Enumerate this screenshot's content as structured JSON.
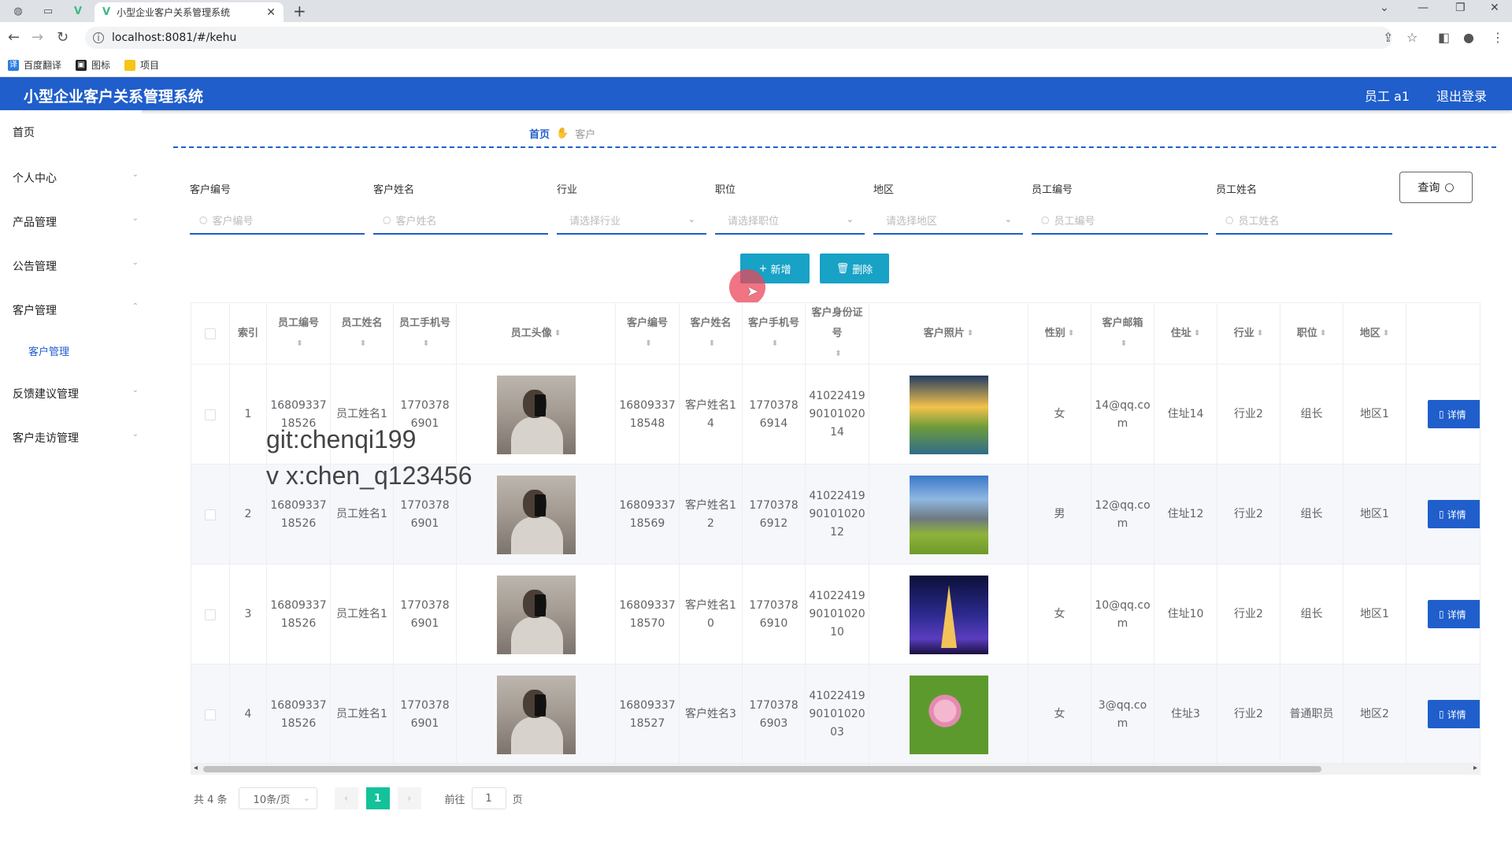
{
  "browser": {
    "tab_title": "小型企业客户关系管理系统",
    "url": "localhost:8081/#/kehu",
    "bookmarks": [
      "百度翻译",
      "图标",
      "项目"
    ]
  },
  "header": {
    "title": "小型企业客户关系管理系统",
    "user": "员工 a1",
    "logout": "退出登录"
  },
  "sidebar": {
    "items": [
      {
        "label": "首页"
      },
      {
        "label": "个人中心"
      },
      {
        "label": "产品管理"
      },
      {
        "label": "公告管理"
      },
      {
        "label": "客户管理"
      },
      {
        "label": "反馈建议管理"
      },
      {
        "label": "客户走访管理"
      }
    ],
    "sub_active": "客户管理"
  },
  "breadcrumb": {
    "home": "首页",
    "current": "客户"
  },
  "search": {
    "fields": [
      {
        "label": "客户编号",
        "placeholder": "客户编号"
      },
      {
        "label": "客户姓名",
        "placeholder": "客户姓名"
      },
      {
        "label": "行业",
        "placeholder": "请选择行业"
      },
      {
        "label": "职位",
        "placeholder": "请选择职位"
      },
      {
        "label": "地区",
        "placeholder": "请选择地区"
      },
      {
        "label": "员工编号",
        "placeholder": "员工编号"
      },
      {
        "label": "员工姓名",
        "placeholder": "员工姓名"
      }
    ],
    "query_label": "查询"
  },
  "actions": {
    "add_label": "新增",
    "delete_label": "删除"
  },
  "table": {
    "headers": [
      "索引",
      "员工编号",
      "员工姓名",
      "员工手机号",
      "员工头像",
      "客户编号",
      "客户姓名",
      "客户手机号",
      "客户身份证号",
      "客户照片",
      "性别",
      "客户邮箱",
      "住址",
      "行业",
      "职位",
      "地区"
    ],
    "detail_label": "详情",
    "rows": [
      {
        "idx": "1",
        "emp_no": "1680933718526",
        "emp_name": "员工姓名1",
        "emp_phone": "17703786901",
        "cust_no": "1680933718548",
        "cust_name": "客户姓名14",
        "cust_phone": "17703786914",
        "cust_id": "410224199010102014",
        "gender": "女",
        "email": "14@qq.com",
        "addr": "住址14",
        "industry": "行业2",
        "position": "组长",
        "region": "地区1"
      },
      {
        "idx": "2",
        "emp_no": "1680933718526",
        "emp_name": "员工姓名1",
        "emp_phone": "17703786901",
        "cust_no": "1680933718569",
        "cust_name": "客户姓名12",
        "cust_phone": "17703786912",
        "cust_id": "410224199010102012",
        "gender": "男",
        "email": "12@qq.com",
        "addr": "住址12",
        "industry": "行业2",
        "position": "组长",
        "region": "地区1"
      },
      {
        "idx": "3",
        "emp_no": "1680933718526",
        "emp_name": "员工姓名1",
        "emp_phone": "17703786901",
        "cust_no": "1680933718570",
        "cust_name": "客户姓名10",
        "cust_phone": "17703786910",
        "cust_id": "410224199010102010",
        "gender": "女",
        "email": "10@qq.com",
        "addr": "住址10",
        "industry": "行业2",
        "position": "组长",
        "region": "地区1"
      },
      {
        "idx": "4",
        "emp_no": "1680933718526",
        "emp_name": "员工姓名1",
        "emp_phone": "17703786901",
        "cust_no": "1680933718527",
        "cust_name": "客户姓名3",
        "cust_phone": "17703786903",
        "cust_id": "410224199010102003",
        "gender": "女",
        "email": "3@qq.com",
        "addr": "住址3",
        "industry": "行业2",
        "position": "普通职员",
        "region": "地区2"
      }
    ]
  },
  "pagination": {
    "total": "共 4 条",
    "page_size": "10条/页",
    "current": "1",
    "goto_prefix": "前往",
    "goto_value": "1",
    "goto_suffix": "页"
  },
  "watermark": {
    "line1": "git:chenqi199",
    "line2": "v x:chen_q123456"
  },
  "colors": {
    "header": "#1f5ecb",
    "action": "#17a2c6",
    "page_active": "#13c29a"
  }
}
